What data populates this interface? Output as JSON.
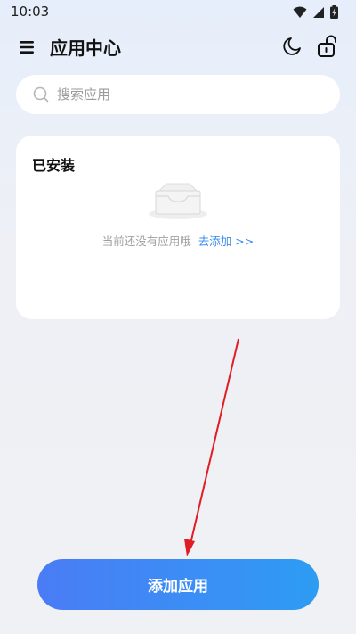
{
  "status_bar": {
    "time": "10:03",
    "icons": [
      "wifi-icon",
      "cellular-signal-icon",
      "battery-charging-icon"
    ]
  },
  "header": {
    "title": "应用中心",
    "icons": [
      "menu-icon",
      "moon-icon",
      "unlock-icon"
    ]
  },
  "search": {
    "placeholder": "搜索应用",
    "value": ""
  },
  "installed": {
    "title": "已安装",
    "empty_text": "当前还没有应用哦",
    "add_link": "去添加 >>"
  },
  "footer": {
    "add_button_label": "添加应用"
  },
  "colors": {
    "accent_link": "#3a8bf0",
    "button_gradient_start": "#4a7cf5",
    "button_gradient_end": "#2d9cf3",
    "annotation_arrow": "#e01c24"
  }
}
